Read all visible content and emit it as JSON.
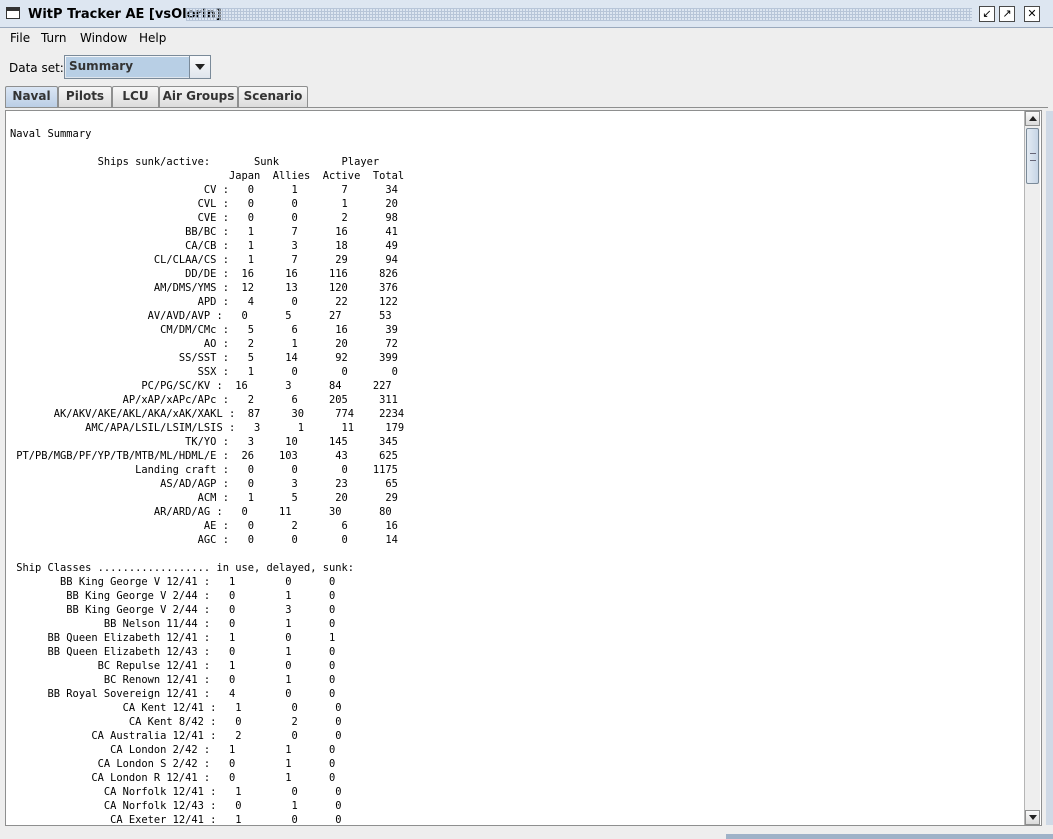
{
  "window": {
    "title": "WitP Tracker AE [vsOlorin]"
  },
  "menu": {
    "file": "File",
    "turn": "Turn",
    "window": "Window",
    "help": "Help"
  },
  "dataset": {
    "label": "Data set:",
    "value": "Summary"
  },
  "tabs": [
    {
      "label": "Naval",
      "active": true
    },
    {
      "label": "Pilots"
    },
    {
      "label": "LCU"
    },
    {
      "label": "Air Groups"
    },
    {
      "label": "Scenario"
    }
  ],
  "report": {
    "text": "Naval Summary\n\n              Ships sunk/active:       Sunk          Player\n                                   Japan  Allies  Active  Total\n                               CV :   0      1       7      34\n                              CVL :   0      0       1      20\n                              CVE :   0      0       2      98\n                            BB/BC :   1      7      16      41\n                            CA/CB :   1      3      18      49\n                       CL/CLAA/CS :   1      7      29      94\n                            DD/DE :  16     16     116     826\n                       AM/DMS/YMS :  12     13     120     376\n                              APD :   4      0      22     122\n                      AV/AVD/AVP :   0      5      27      53\n                        CM/DM/CMc :   5      6      16      39\n                               AO :   2      1      20      72\n                           SS/SST :   5     14      92     399\n                              SSX :   1      0       0       0\n                     PC/PG/SC/KV :  16      3      84     227\n                  AP/xAP/xAPc/APc :   2      6     205     311\n       AK/AKV/AKE/AKL/AKA/xAK/XAKL :  87     30     774    2234\n            AMC/APA/LSIL/LSIM/LSIS :   3      1      11     179\n                            TK/YO :   3     10     145     345\n PT/PB/MGB/PF/YP/TB/MTB/ML/HDML/E :  26    103      43     625\n                    Landing craft :   0      0       0    1175\n                        AS/AD/AGP :   0      3      23      65\n                              ACM :   1      5      20      29\n                       AR/ARD/AG :   0     11      30      80\n                               AE :   0      2       6      16\n                              AGC :   0      0       0      14\n\n Ship Classes .................. in use, delayed, sunk:\n        BB King George V 12/41 :   1        0      0\n         BB King George V 2/44 :   0        1      0\n         BB King George V 2/44 :   0        3      0\n               BB Nelson 11/44 :   0        1      0\n      BB Queen Elizabeth 12/41 :   1        0      1\n      BB Queen Elizabeth 12/43 :   0        1      0\n              BC Repulse 12/41 :   1        0      0\n               BC Renown 12/41 :   0        1      0\n      BB Royal Sovereign 12/41 :   4        0      0\n                  CA Kent 12/41 :   1        0      0\n                   CA Kent 8/42 :   0        2      0\n             CA Australia 12/41 :   2        0      0\n                CA London 2/42 :   1        1      0\n              CA London S 2/42 :   0        1      0\n             CA London R 12/41 :   0        1      0\n               CA Norfolk 12/41 :   1        0      0\n               CA Norfolk 12/43 :   0        1      0\n                CA Exeter 12/41 :   1        0      0"
  }
}
